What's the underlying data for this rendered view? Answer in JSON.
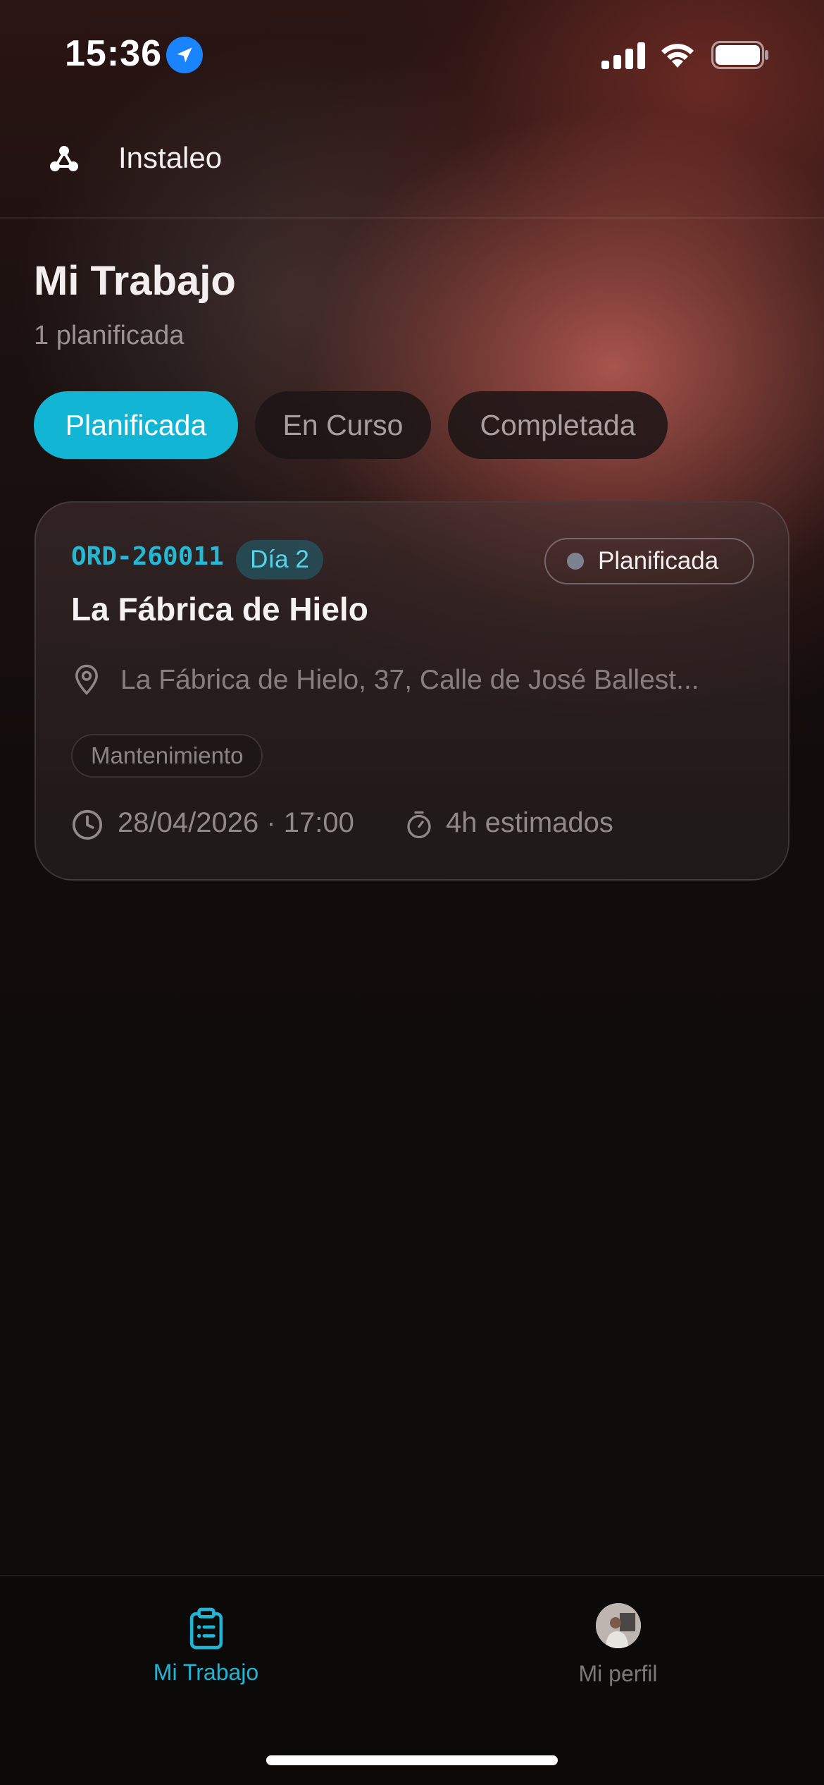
{
  "status_bar": {
    "time": "15:36",
    "location_icon": "location-arrow-icon",
    "signal_icon": "cellular-signal-icon",
    "wifi_icon": "wifi-icon",
    "battery_icon": "battery-icon"
  },
  "header": {
    "logo_icon": "three-nodes-logo-icon",
    "app_name": "Instaleo"
  },
  "page": {
    "title": "Mi Trabajo",
    "subtitle": "1 planificada"
  },
  "filters": [
    {
      "label": "Planificada",
      "active": true
    },
    {
      "label": "En Curso",
      "active": false
    },
    {
      "label": "Completada",
      "active": false
    }
  ],
  "orders": [
    {
      "code": "ORD-260011",
      "day_badge": "Día 2",
      "status": "Planificada",
      "title": "La Fábrica de Hielo",
      "address": "La Fábrica de Hielo, 37, Calle de José Ballest...",
      "category": "Mantenimiento",
      "datetime": "28/04/2026 · 17:00",
      "estimate": "4h estimados"
    }
  ],
  "tab_bar": {
    "tabs": [
      {
        "label": "Mi Trabajo",
        "icon": "clipboard-list-icon",
        "active": true
      },
      {
        "label": "Mi perfil",
        "icon": "avatar",
        "active": false
      }
    ]
  },
  "colors": {
    "accent": "#13b5d4",
    "background": "#0f0b0b",
    "warm_glow": "#b05850"
  }
}
